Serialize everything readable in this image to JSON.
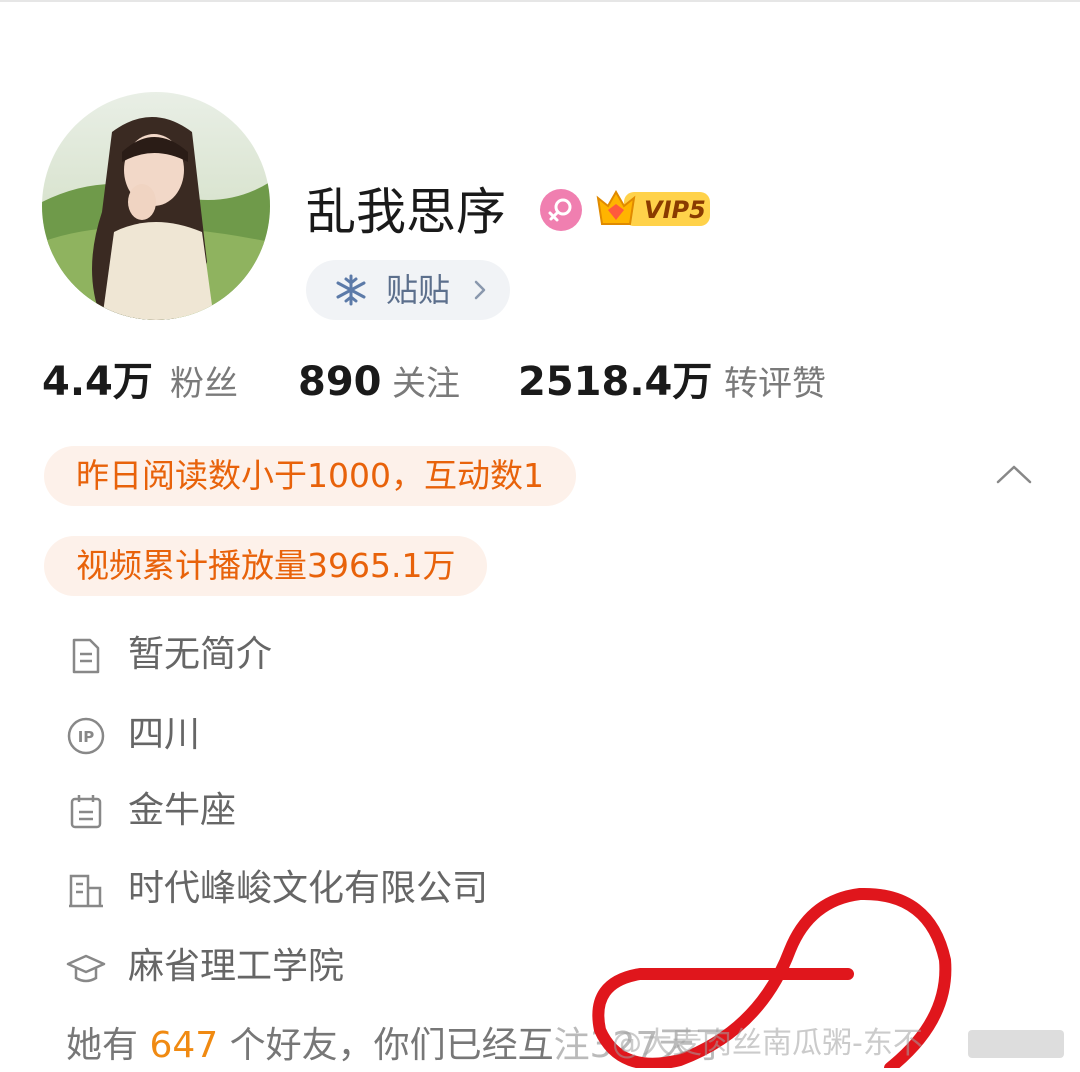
{
  "profile": {
    "name": "乱我思序",
    "vip_label": "VIP5",
    "tag_label": "贴贴"
  },
  "stats": [
    {
      "value": "4.4万",
      "label": "粉丝"
    },
    {
      "value": "890",
      "label": "关注"
    },
    {
      "value": "2518.4万",
      "label": "转评赞"
    }
  ],
  "highlights": [
    "昨日阅读数小于1000，互动数1",
    "视频累计播放量3965.1万"
  ],
  "info": [
    {
      "icon": "document-icon",
      "text": "暂无简介"
    },
    {
      "icon": "ip-icon",
      "text": "四川"
    },
    {
      "icon": "calendar-icon",
      "text": "金牛座"
    },
    {
      "icon": "building-icon",
      "text": "时代峰峻文化有限公司"
    },
    {
      "icon": "graduation-cap-icon",
      "text": "麻省理工学院"
    }
  ],
  "friends": {
    "prefix": "她有",
    "count": "647",
    "middle": "个好友，你们已经互",
    "suffix": "注327天了"
  },
  "watermark": "@大麦肉丝南瓜粥-东不",
  "colors": {
    "accent_orange": "#e8620a",
    "highlight_bg": "#fdf1ea",
    "tag_blue": "#5c6f8c",
    "gender_pink": "#f07fb0",
    "annotation_red": "#e0161c"
  }
}
